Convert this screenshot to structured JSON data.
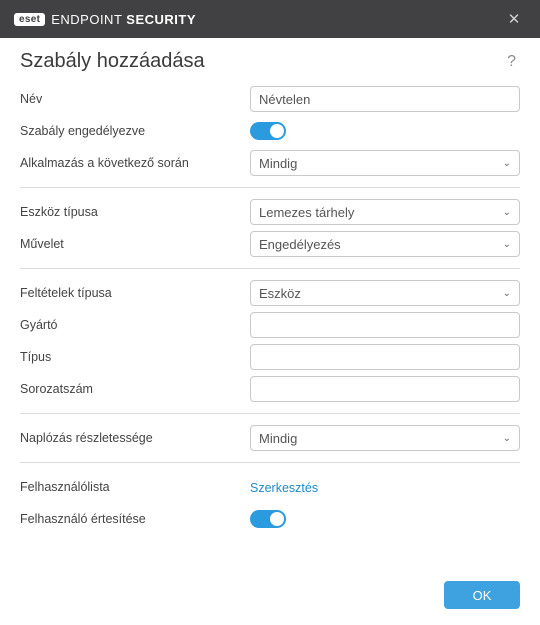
{
  "titlebar": {
    "brand_badge": "eset",
    "brand_thin": "ENDPOINT ",
    "brand_bold": "SECURITY",
    "close_glyph": "✕"
  },
  "header": {
    "title": "Szabály hozzáadása",
    "help_glyph": "?"
  },
  "fields": {
    "name_label": "Név",
    "name_value": "Névtelen",
    "rule_enabled_label": "Szabály engedélyezve",
    "apply_during_label": "Alkalmazás a következő során",
    "apply_during_value": "Mindig",
    "device_type_label": "Eszköz típusa",
    "device_type_value": "Lemezes tárhely",
    "action_label": "Művelet",
    "action_value": "Engedélyezés",
    "criteria_type_label": "Feltételek típusa",
    "criteria_type_value": "Eszköz",
    "vendor_label": "Gyártó",
    "vendor_value": "",
    "model_label": "Típus",
    "model_value": "",
    "serial_label": "Sorozatszám",
    "serial_value": "",
    "log_severity_label": "Naplózás részletessége",
    "log_severity_value": "Mindig",
    "user_list_label": "Felhasználólista",
    "user_list_link": "Szerkesztés",
    "notify_user_label": "Felhasználó értesítése"
  },
  "footer": {
    "ok": "OK"
  }
}
